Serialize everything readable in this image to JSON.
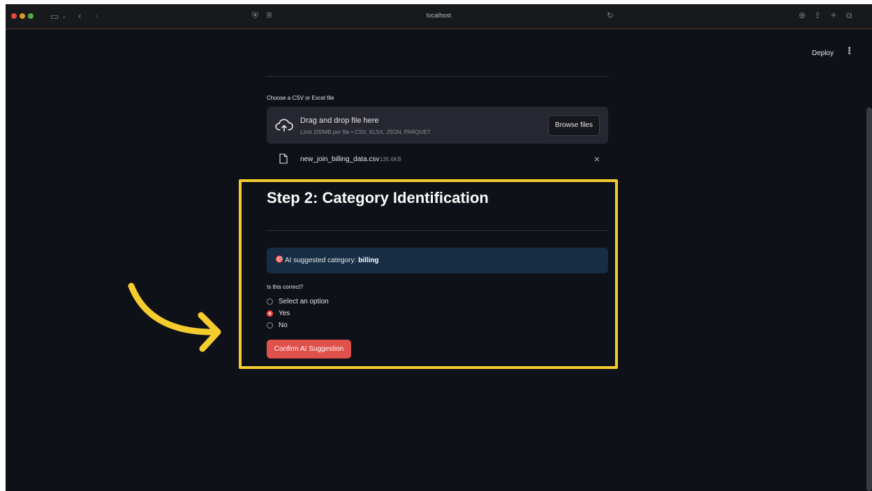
{
  "browser": {
    "url": "localhost"
  },
  "header": {
    "deploy_label": "Deploy",
    "menu_glyph": "⋮"
  },
  "uploader": {
    "label": "Choose a CSV or Excel file",
    "drop_title": "Drag and drop file here",
    "drop_subtitle": "Limit 200MB per file • CSV, XLSX, JSON, PARQUET",
    "browse_label": "Browse files",
    "file": {
      "name": "new_join_billing_data.csv",
      "size": "135.6KB"
    }
  },
  "step2": {
    "title": "Step 2: Category Identification",
    "info_prefix": "AI suggested category: ",
    "info_category": "billing",
    "question": "Is this correct?",
    "options": [
      "Select an option",
      "Yes",
      "No"
    ],
    "selected_option": "Yes",
    "confirm_label": "Confirm AI Suggestion"
  },
  "colors": {
    "background": "#0e1117",
    "primary": "#ff4b4b",
    "info_bg": "#172d43",
    "annotation": "#f5cc2e"
  }
}
